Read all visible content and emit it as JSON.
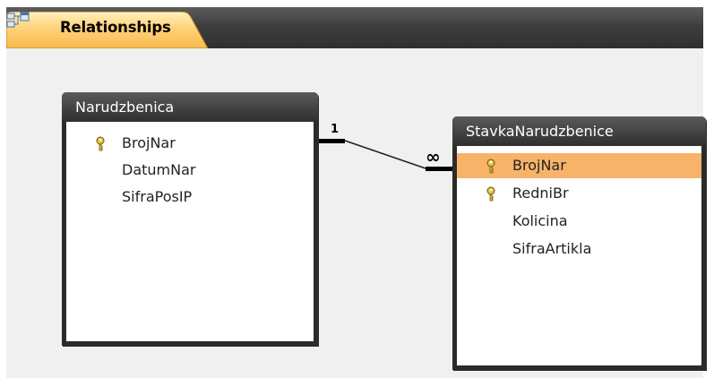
{
  "tab": {
    "label": "Relationships",
    "icon": "relationships-icon"
  },
  "tables": [
    {
      "name": "Narudzbenica",
      "fields": [
        {
          "name": "BrojNar",
          "primary_key": true,
          "selected": false
        },
        {
          "name": "DatumNar",
          "primary_key": false,
          "selected": false
        },
        {
          "name": "SifraPosIP",
          "primary_key": false,
          "selected": false
        }
      ]
    },
    {
      "name": "StavkaNarudzbenice",
      "fields": [
        {
          "name": "BrojNar",
          "primary_key": true,
          "selected": true
        },
        {
          "name": "RedniBr",
          "primary_key": true,
          "selected": false
        },
        {
          "name": "Kolicina",
          "primary_key": false,
          "selected": false
        },
        {
          "name": "SifraArtikla",
          "primary_key": false,
          "selected": false
        }
      ]
    }
  ],
  "relationship": {
    "one_label": "1",
    "many_label": "∞"
  },
  "colors": {
    "tab_fill": "#ffcf73",
    "selected_row": "#f7b36a",
    "title_bar": "#2f2f2f",
    "canvas": "#f0f0f0"
  }
}
